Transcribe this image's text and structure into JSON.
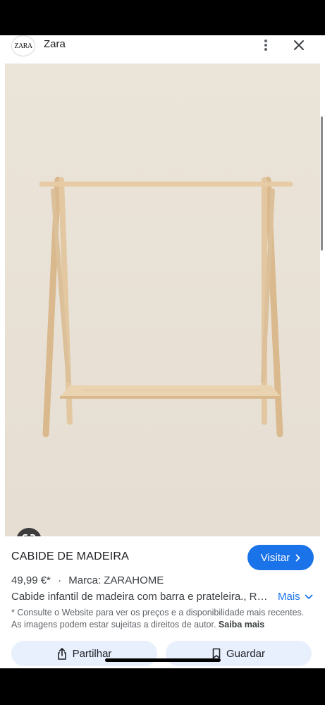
{
  "header": {
    "logo_text": "ZARA",
    "site_name": "Zara"
  },
  "product": {
    "title": "CABIDE DE MADEIRA",
    "price": "49,99 €*",
    "separator": "·",
    "brand": "Marca: ZARAHOME",
    "description": "Cabide infantil de madeira com barra e prateleira., Requer montagem.",
    "more_label": "Mais"
  },
  "actions": {
    "visit_label": "Visitar",
    "share_label": "Partilhar",
    "save_label": "Guardar"
  },
  "notice": {
    "text": "* Consulte o Website para ver os preços e a disponibilidade mais recentes. As imagens podem estar sujeitas a direitos de autor.",
    "link": "Saiba mais"
  },
  "icons": {
    "menu": "more-vert-icon",
    "close": "close-icon",
    "lens": "google-lens-icon",
    "visit": "chevron-right-icon",
    "more": "chevron-down-icon",
    "share": "share-icon",
    "save": "bookmark-icon"
  },
  "colors": {
    "accent": "#1a73e8",
    "button_bg": "#e8f0fe",
    "image_bg": "#ebe4d9",
    "wood": "#e2c7a0"
  }
}
